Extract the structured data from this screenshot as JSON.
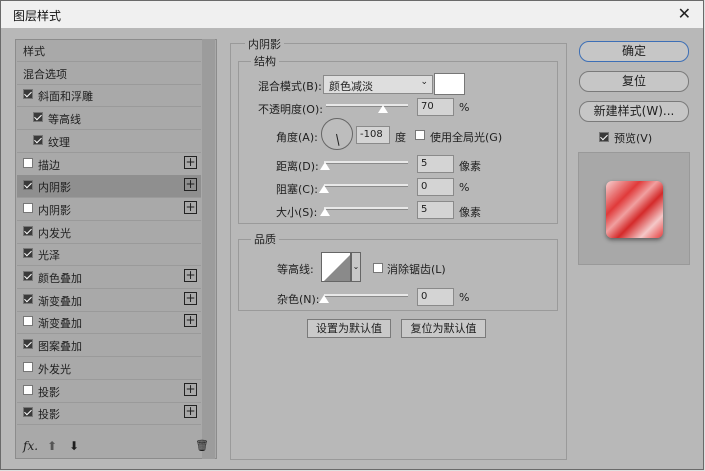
{
  "window": {
    "title": "图层样式",
    "close_glyph": "✕"
  },
  "left_panel": {
    "items": [
      {
        "label": "样式",
        "has_checkbox": false,
        "checked": false,
        "has_plus": false,
        "selected": false
      },
      {
        "label": "混合选项",
        "has_checkbox": false,
        "checked": false,
        "has_plus": false,
        "selected": false
      },
      {
        "label": "斜面和浮雕",
        "has_checkbox": true,
        "checked": true,
        "has_plus": false,
        "selected": false
      },
      {
        "label": "等高线",
        "has_checkbox": true,
        "checked": true,
        "has_plus": false,
        "selected": false,
        "indent": true
      },
      {
        "label": "纹理",
        "has_checkbox": true,
        "checked": true,
        "has_plus": false,
        "selected": false,
        "indent": true
      },
      {
        "label": "描边",
        "has_checkbox": true,
        "checked": false,
        "has_plus": true,
        "selected": false
      },
      {
        "label": "内阴影",
        "has_checkbox": true,
        "checked": true,
        "has_plus": true,
        "selected": true
      },
      {
        "label": "内阴影",
        "has_checkbox": true,
        "checked": false,
        "has_plus": true,
        "selected": false
      },
      {
        "label": "内发光",
        "has_checkbox": true,
        "checked": true,
        "has_plus": false,
        "selected": false
      },
      {
        "label": "光泽",
        "has_checkbox": true,
        "checked": true,
        "has_plus": false,
        "selected": false
      },
      {
        "label": "颜色叠加",
        "has_checkbox": true,
        "checked": true,
        "has_plus": true,
        "selected": false
      },
      {
        "label": "渐变叠加",
        "has_checkbox": true,
        "checked": true,
        "has_plus": true,
        "selected": false
      },
      {
        "label": "渐变叠加",
        "has_checkbox": true,
        "checked": false,
        "has_plus": true,
        "selected": false
      },
      {
        "label": "图案叠加",
        "has_checkbox": true,
        "checked": true,
        "has_plus": false,
        "selected": false
      },
      {
        "label": "外发光",
        "has_checkbox": true,
        "checked": false,
        "has_plus": false,
        "selected": false
      },
      {
        "label": "投影",
        "has_checkbox": true,
        "checked": false,
        "has_plus": true,
        "selected": false
      },
      {
        "label": "投影",
        "has_checkbox": true,
        "checked": true,
        "has_plus": true,
        "selected": false
      }
    ],
    "bottom": {
      "fx": "fx.",
      "up": "⬆",
      "down": "⬇",
      "trash": "🗑"
    }
  },
  "inner_shadow": {
    "title": "内阴影",
    "structure": {
      "title": "结构",
      "blend_mode_label": "混合模式(B):",
      "blend_mode_value": "颜色减淡",
      "blend_color": "#ffffff",
      "opacity_label": "不透明度(O):",
      "opacity_value": "70",
      "opacity_unit": "%",
      "angle_label": "角度(A):",
      "angle_value": "-108",
      "angle_unit": "度",
      "global_light_label": "使用全局光(G)",
      "global_light_checked": false,
      "distance_label": "距离(D):",
      "distance_value": "5",
      "distance_unit": "像素",
      "choke_label": "阻塞(C):",
      "choke_value": "0",
      "choke_unit": "%",
      "size_label": "大小(S):",
      "size_value": "5",
      "size_unit": "像素"
    },
    "quality": {
      "title": "品质",
      "contour_label": "等高线:",
      "antialias_label": "消除锯齿(L)",
      "antialias_checked": false,
      "noise_label": "杂色(N):",
      "noise_value": "0",
      "noise_unit": "%"
    },
    "set_default": "设置为默认值",
    "reset_default": "复位为默认值"
  },
  "right_buttons": {
    "ok": "确定",
    "reset": "复位",
    "new_style": "新建样式(W)...",
    "preview_label": "预览(V)",
    "preview_checked": true
  },
  "colors": {
    "accent": "#3d6fb6",
    "swatch_red": "#e03a3a"
  }
}
